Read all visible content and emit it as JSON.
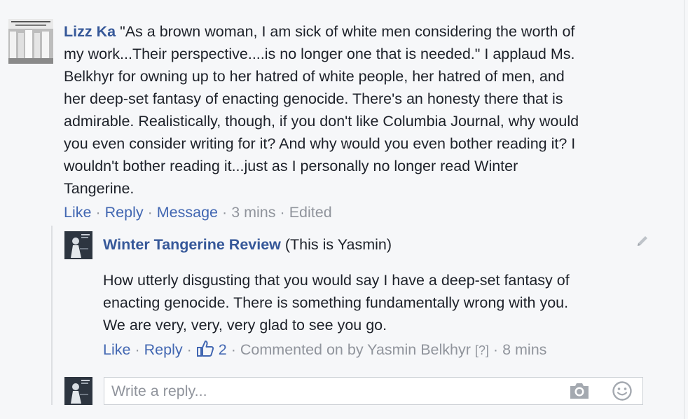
{
  "colors": {
    "link": "#365899",
    "action_link": "#4267b2",
    "meta_text": "#90949c",
    "body_text": "#1d2129",
    "background": "#f6f7f9"
  },
  "comment": {
    "author": "Lizz Ka",
    "avatar_icon": "protest-photo-avatar",
    "lines": [
      "\"As a brown woman, I am sick of white men considering the worth of",
      "my work...Their perspective....is no longer one that is needed.\" I applaud Ms.",
      "Belkhyr for owning up to her hatred of white people, her hatred of men, and",
      "her deep-set fantasy of enacting genocide. There's an honesty there that is",
      "admirable. Realistically, though, if you don't like Columbia Journal, why would",
      "you even consider writing for it? And why would you even bother reading it? I",
      "wouldn't bother reading it...just as I personally no longer read Winter",
      "Tangerine."
    ],
    "actions": {
      "like": "Like",
      "reply": "Reply",
      "message": "Message",
      "time": "3 mins",
      "edited": "Edited"
    }
  },
  "reply": {
    "author": "Winter Tangerine Review",
    "author_note": "(This is Yasmin)",
    "avatar_icon": "magazine-cover-avatar",
    "lines": [
      "How utterly disgusting that you would say I have a deep-set fantasy of",
      "enacting genocide. There is something fundamentally wrong with you.",
      "We are very, very, very glad to see you go."
    ],
    "actions": {
      "like": "Like",
      "reply": "Reply",
      "like_count": "2",
      "commented_by": "Commented on by Yasmin Belkhyr",
      "help": "[?]",
      "time": "8 mins"
    }
  },
  "composer": {
    "placeholder": "Write a reply...",
    "camera_icon": "camera-icon",
    "emoji_icon": "smiley-icon"
  }
}
